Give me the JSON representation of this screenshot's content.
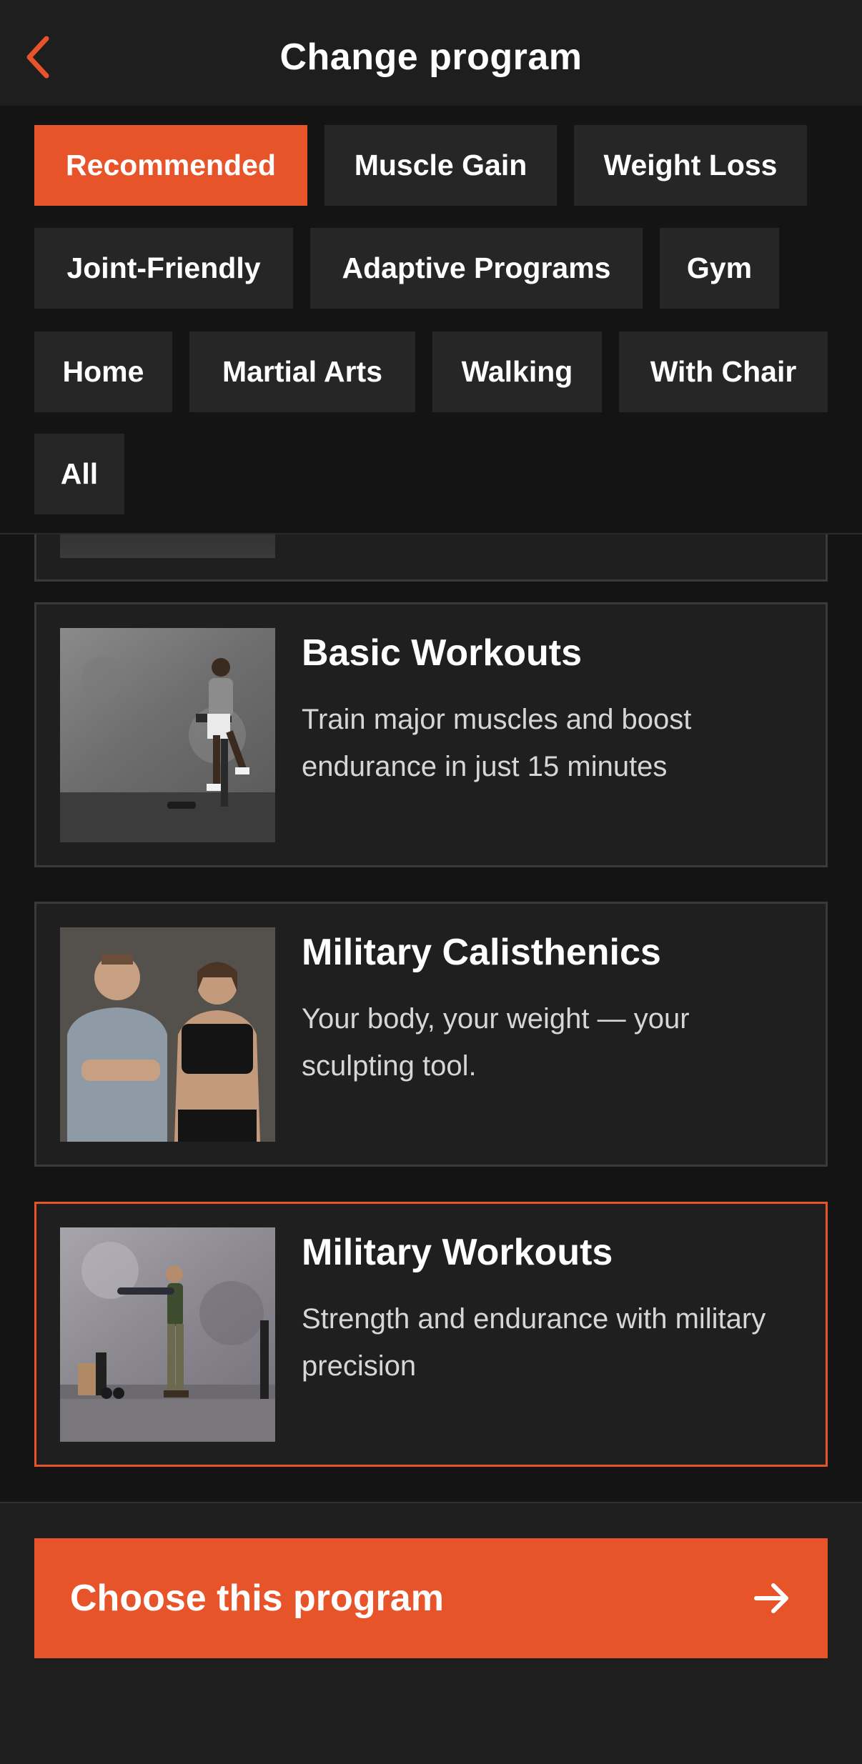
{
  "header": {
    "title": "Change program",
    "back_icon": "chevron-left-icon"
  },
  "filters": [
    {
      "label": "Recommended",
      "active": true
    },
    {
      "label": "Muscle Gain",
      "active": false
    },
    {
      "label": "Weight Loss",
      "active": false
    },
    {
      "label": "Joint-Friendly",
      "active": false
    },
    {
      "label": "Adaptive Programs",
      "active": false
    },
    {
      "label": "Gym",
      "active": false
    },
    {
      "label": "Home",
      "active": false
    },
    {
      "label": "Martial Arts",
      "active": false
    },
    {
      "label": "Walking",
      "active": false
    },
    {
      "label": "With Chair",
      "active": false
    },
    {
      "label": "All",
      "active": false
    }
  ],
  "programs": [
    {
      "title": "Basic Workouts",
      "description": "Train major muscles and boost endurance in just 15 minutes",
      "selected": false
    },
    {
      "title": "Military Calisthenics",
      "description": "Your body, your weight — your sculpting tool.",
      "selected": false
    },
    {
      "title": "Military Workouts",
      "description": "Strength and endurance with military precision",
      "selected": true
    }
  ],
  "footer": {
    "cta_label": "Choose this program",
    "cta_icon": "arrow-right-icon"
  },
  "colors": {
    "accent": "#e8542a",
    "background": "#141414",
    "surface": "#1f1f1f"
  }
}
